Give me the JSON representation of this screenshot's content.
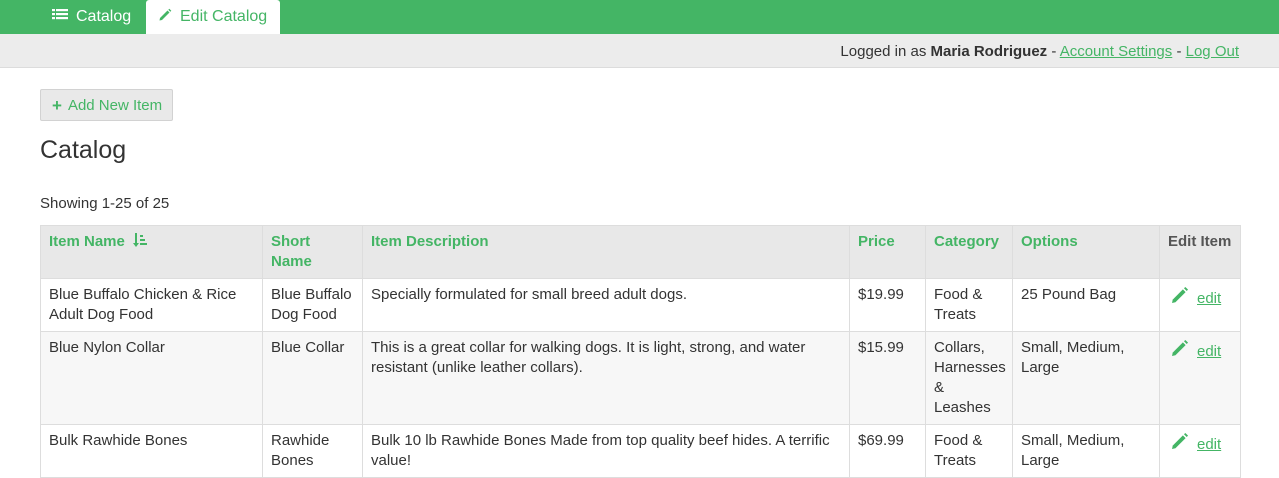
{
  "nav": {
    "tabs": [
      {
        "label": "Catalog",
        "icon": "list-icon"
      },
      {
        "label": "Edit Catalog",
        "icon": "pencil-icon",
        "active": true
      }
    ]
  },
  "account": {
    "prefix": "Logged in as",
    "user": "Maria Rodriguez",
    "sep1": " - ",
    "settings": "Account Settings",
    "sep2": " - ",
    "logout": "Log Out"
  },
  "add_button": {
    "label": "Add New Item"
  },
  "page_title": "Catalog",
  "showing": "Showing 1-25 of 25",
  "table": {
    "headers": [
      "Item Name",
      "Short Name",
      "Item Description",
      "Price",
      "Category",
      "Options",
      "Edit Item"
    ],
    "rows": [
      {
        "name": "Blue Buffalo Chicken & Rice Adult Dog Food",
        "short": "Blue Buffalo Dog Food",
        "desc": "Specially formulated for small breed adult dogs.",
        "price": "$19.99",
        "category": "Food & Treats",
        "options": "25 Pound Bag",
        "edit": "edit"
      },
      {
        "name": "Blue Nylon Collar",
        "short": "Blue Collar",
        "desc": "This is a great collar for walking dogs. It is light, strong, and water resistant (unlike leather collars).",
        "price": "$15.99",
        "category": "Collars, Harnesses & Leashes",
        "options": "Small, Medium, Large",
        "edit": "edit"
      },
      {
        "name": "Bulk Rawhide Bones",
        "short": "Rawhide Bones",
        "desc": "Bulk 10 lb Rawhide Bones Made from top quality beef hides. A terrific value!",
        "price": "$69.99",
        "category": "Food & Treats",
        "options": "Small, Medium, Large",
        "edit": "edit"
      }
    ]
  },
  "colors": {
    "accent": "#44b565",
    "header_bg": "#e8e8e8",
    "subbar_bg": "#ececec"
  }
}
